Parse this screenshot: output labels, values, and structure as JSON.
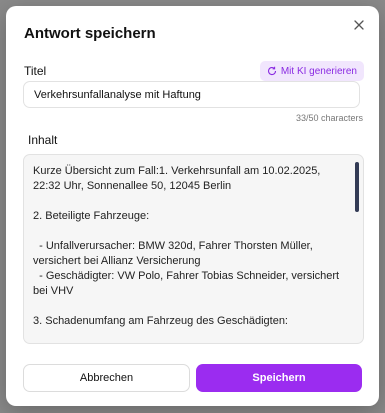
{
  "dialog": {
    "title": "Antwort speichern",
    "close_icon": "close-icon"
  },
  "title_field": {
    "label": "Titel",
    "value": "Verkehrsunfallanalyse mit Haftung",
    "char_count": "33/50 characters"
  },
  "ai_button": {
    "label": "Mit KI generieren",
    "icon": "refresh-icon"
  },
  "content_field": {
    "label": "Inhalt",
    "value": "Kurze Übersicht zum Fall:1. Verkehrsunfall am 10.02.2025, 22:32 Uhr, Sonnenallee 50, 12045 Berlin\n\n2. Beteiligte Fahrzeuge:\n\n  - Unfallverursacher: BMW 320d, Fahrer Thorsten Müller, versichert bei Allianz Versicherung\n  - Geschädigter: VW Polo, Fahrer Tobias Schneider, versichert bei VHV\n\n3. Schadenumfang am Fahrzeug des Geschädigten:\n\n  - Frontstoßstange eingedrückt, Riss rechts"
  },
  "footer": {
    "cancel_label": "Abbrechen",
    "save_label": "Speichern"
  },
  "colors": {
    "accent": "#9b2cf0",
    "ai_button_bg": "#f1e6fd",
    "ai_button_text": "#8a2be2"
  }
}
